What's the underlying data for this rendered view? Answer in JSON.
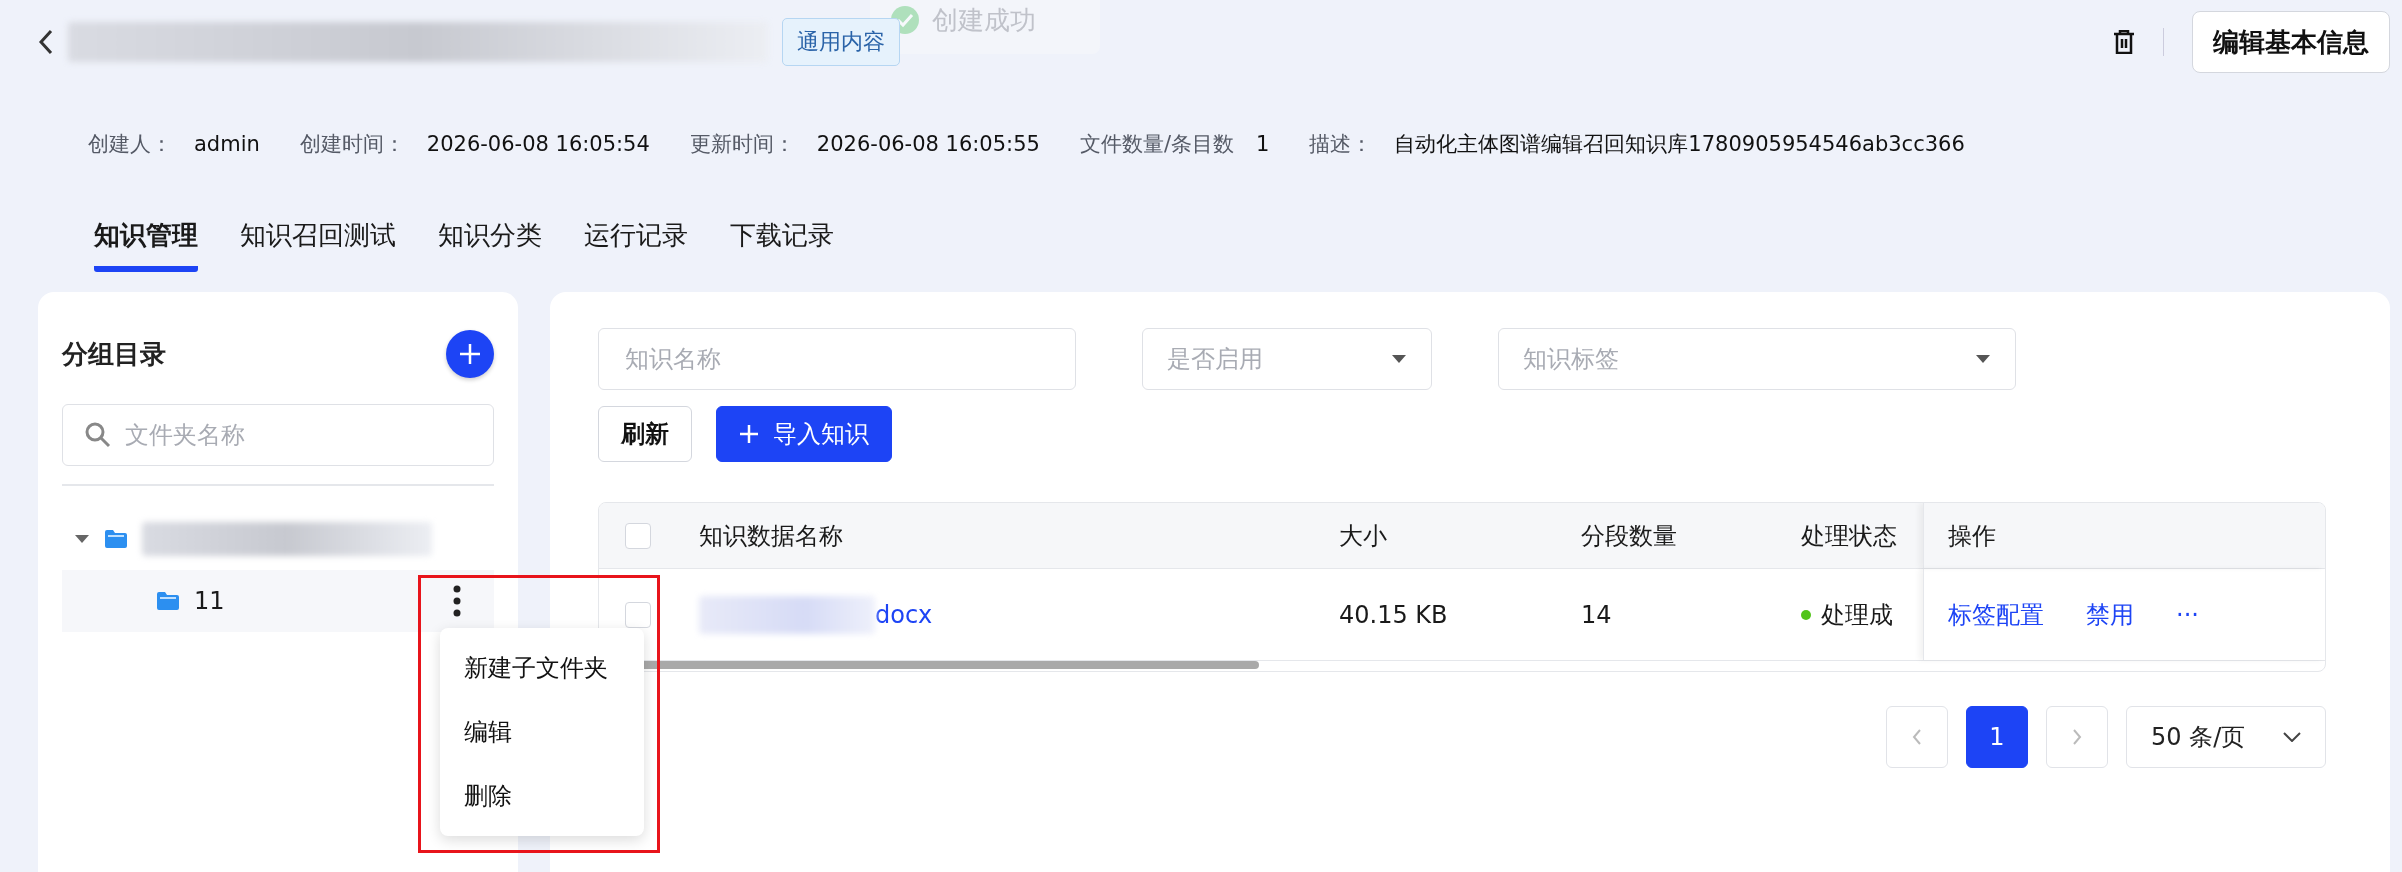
{
  "header": {
    "tag": "通用内容",
    "toast": "创建成功",
    "edit_button": "编辑基本信息"
  },
  "meta": [
    {
      "label": "创建人：",
      "value": "admin"
    },
    {
      "label": "创建时间：",
      "value": "2026-06-08 16:05:54"
    },
    {
      "label": "更新时间：",
      "value": "2026-06-08 16:05:55"
    },
    {
      "label": "文件数量/条目数",
      "value": "1"
    },
    {
      "label": "描述：",
      "value": "自动化主体图谱编辑召回知识库1780905954546ab3cc366"
    }
  ],
  "tabs": [
    {
      "label": "知识管理",
      "selected": true
    },
    {
      "label": "知识召回测试",
      "selected": false
    },
    {
      "label": "知识分类",
      "selected": false
    },
    {
      "label": "运行记录",
      "selected": false
    },
    {
      "label": "下载记录",
      "selected": false
    }
  ],
  "sidebar": {
    "title": "分组目录",
    "search": {
      "placeholder": "文件夹名称"
    },
    "tree": [
      {
        "expanded": true,
        "children": [
          {
            "label": "11",
            "selected": true
          }
        ]
      }
    ],
    "context_menu": [
      "新建子文件夹",
      "编辑",
      "删除"
    ]
  },
  "filters": [
    {
      "kind": "input",
      "placeholder": "知识名称"
    },
    {
      "kind": "select",
      "placeholder": "是否启用"
    },
    {
      "kind": "select",
      "placeholder": "知识标签"
    }
  ],
  "buttons": [
    {
      "kind": "outline",
      "label": "刷新"
    },
    {
      "kind": "primary",
      "label": "导入知识"
    }
  ],
  "table": {
    "header_checked": false,
    "columns": [
      "知识数据名称",
      "大小",
      "分段数量",
      "处理状态",
      "操作"
    ],
    "rows": [
      {
        "checked": false,
        "name": "docx",
        "size": "40.15 KB",
        "segments": "14",
        "status": "处理成",
        "color": "#52c41a",
        "actions": [
          "标签配置",
          "禁用",
          "···"
        ]
      }
    ]
  },
  "pagination": {
    "pages": [
      {
        "label": "1",
        "selected": true
      }
    ],
    "page_size": "50 条/页"
  }
}
